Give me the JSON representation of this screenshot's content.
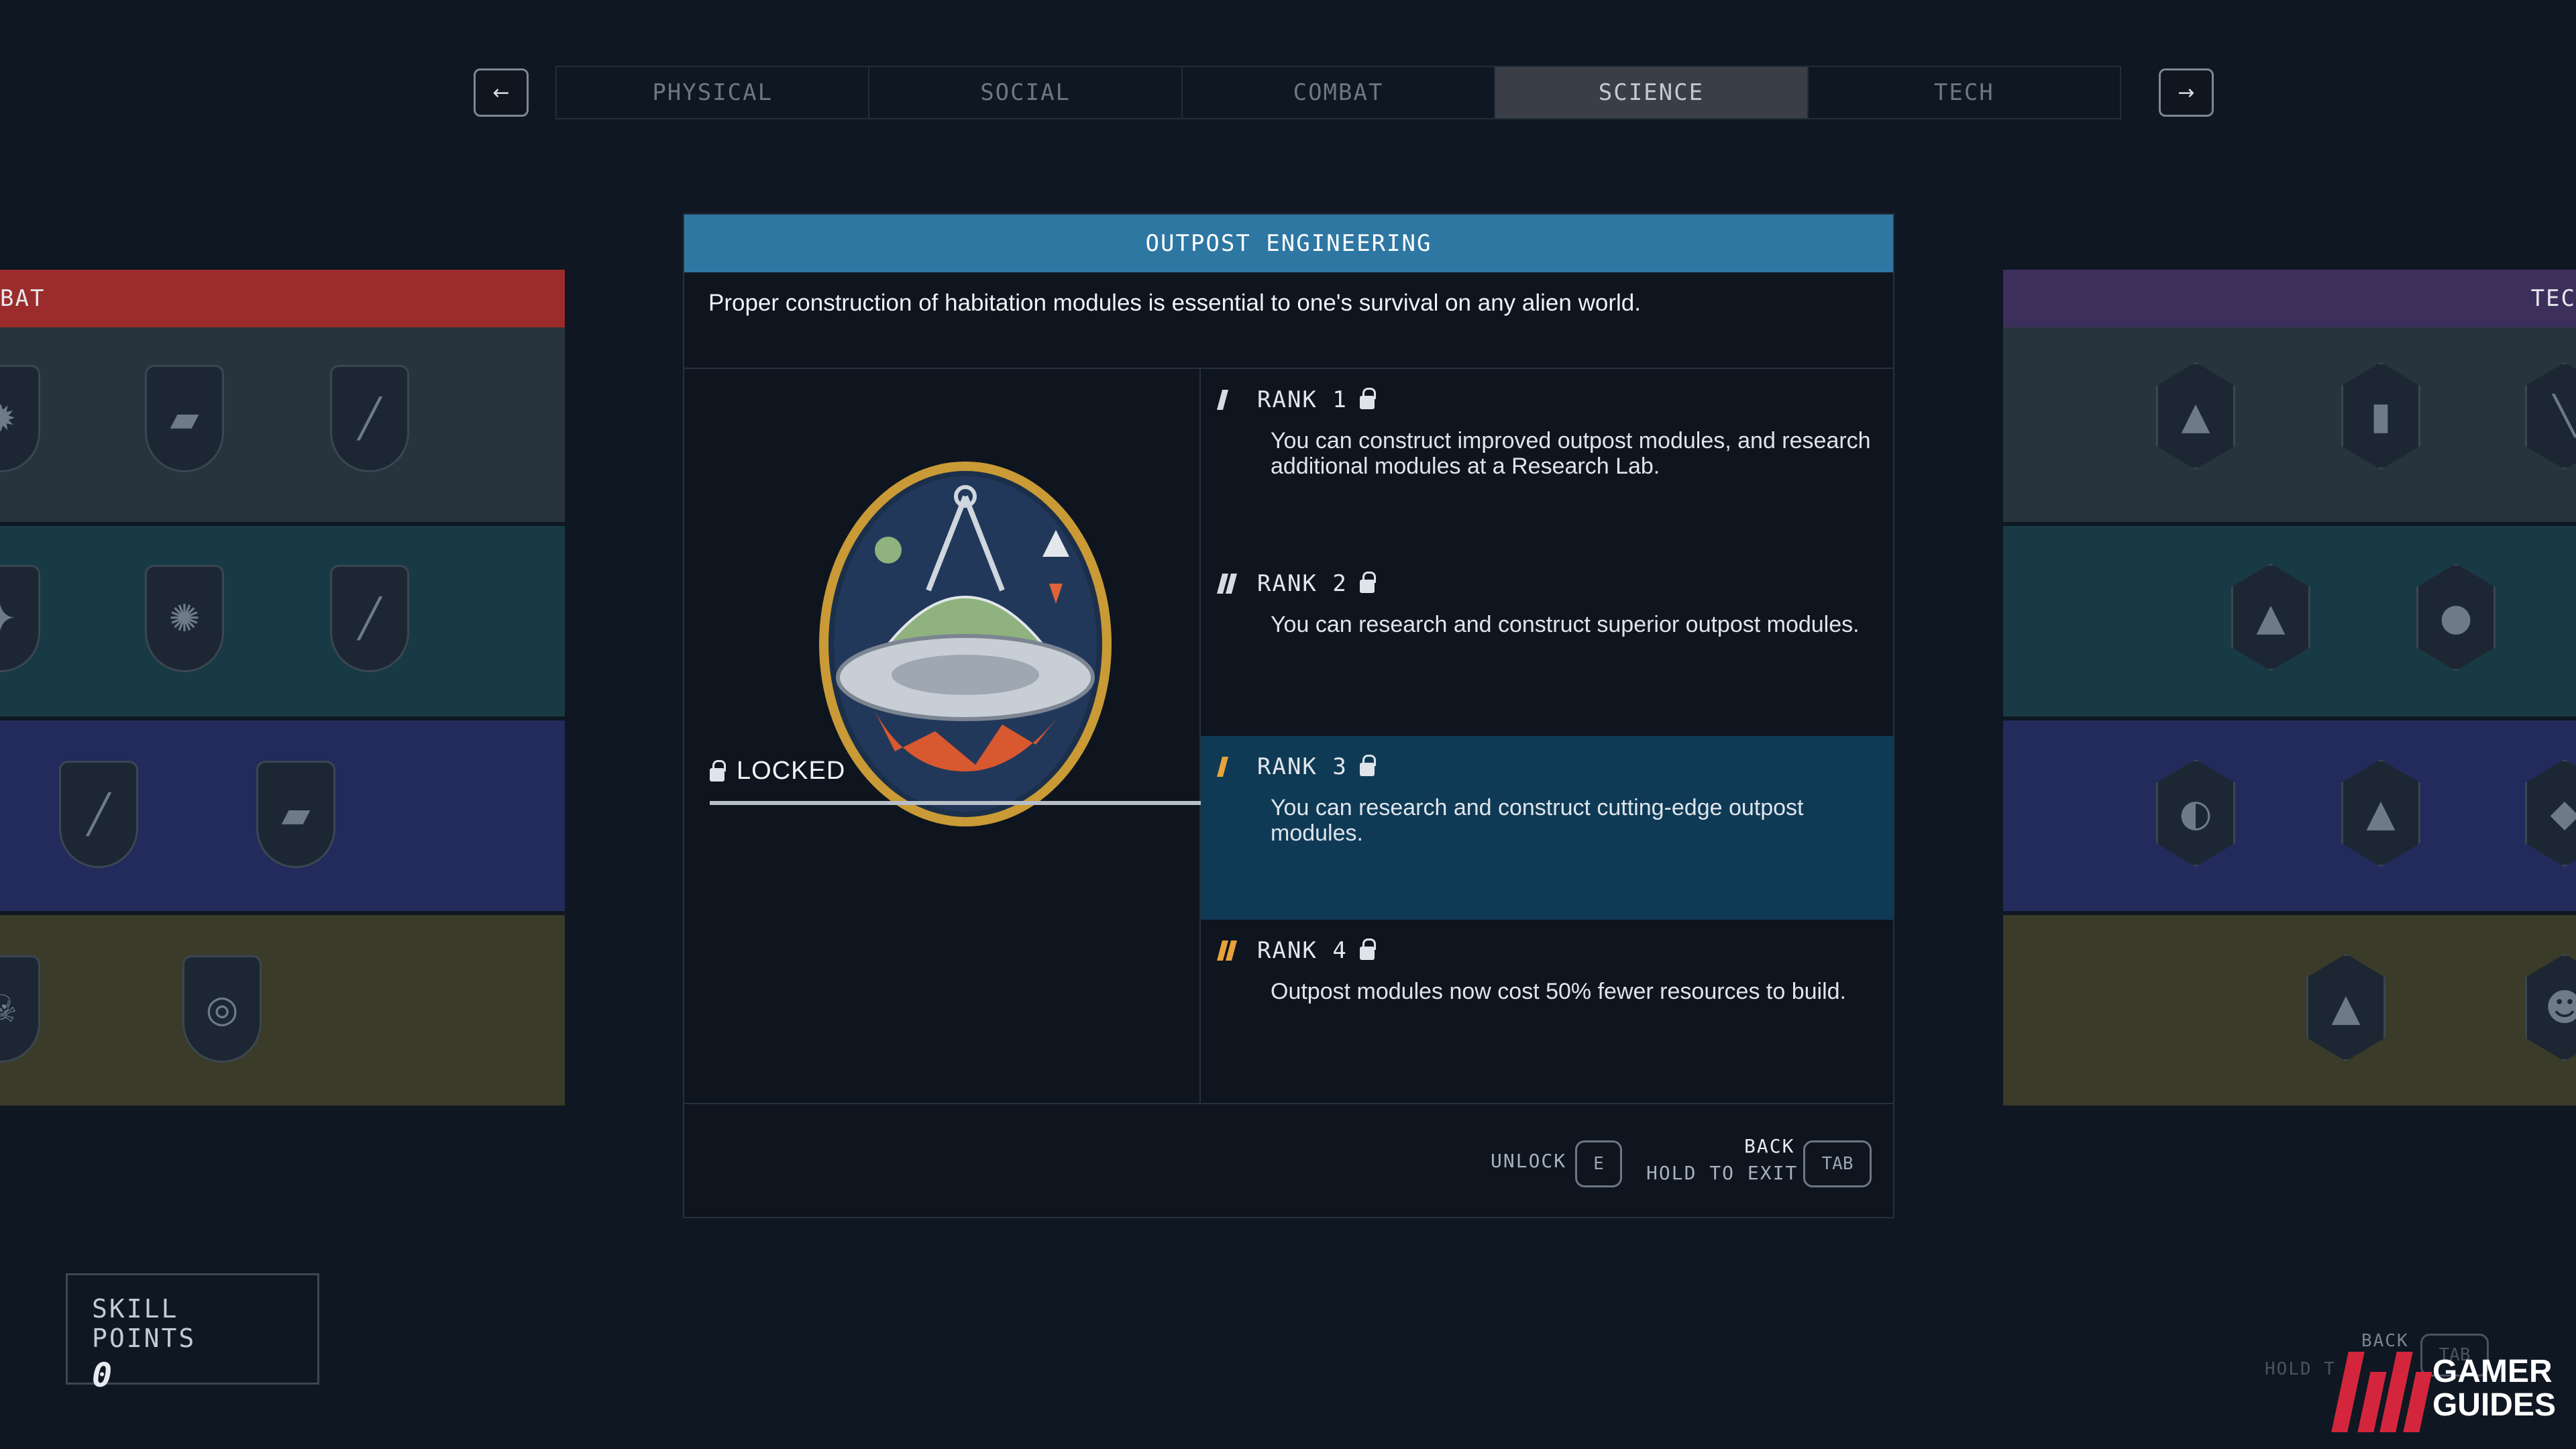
{
  "nav": {
    "prev_label": "←",
    "next_label": "→",
    "tabs": [
      {
        "label": "PHYSICAL"
      },
      {
        "label": "SOCIAL"
      },
      {
        "label": "COMBAT"
      },
      {
        "label": "SCIENCE",
        "active": true
      },
      {
        "label": "TECH"
      }
    ]
  },
  "left_panel": {
    "header": "BAT",
    "header_color": "#9c2b2b",
    "row_colors": [
      "#27343d",
      "#183a44",
      "#232b5c",
      "#3a3b28"
    ],
    "badge_icons": [
      "sun-icon",
      "pistol-icon",
      "rifle-icon",
      "star-icon",
      "burst-icon",
      "rifle-icon",
      "sniper-icon",
      "revolver-icon",
      "skull-icon",
      "target-icon"
    ]
  },
  "right_panel": {
    "header": "TEC",
    "header_color": "#3d2f5c",
    "row_colors": [
      "#27343d",
      "#183a44",
      "#232b5c",
      "#3a3b28"
    ],
    "badge_icons": [
      "ship-icon",
      "jetpack-icon",
      "tool-icon",
      "ship-icon",
      "rocket-icon",
      "planet-icon",
      "ship-icon",
      "robot-icon",
      "ship-icon",
      "astronaut-icon"
    ]
  },
  "dialog": {
    "title": "OUTPOST ENGINEERING",
    "description": "Proper construction of habitation modules is essential to one's survival on any alien world.",
    "status": "LOCKED",
    "ranks": [
      {
        "label": "RANK 1",
        "text": "You can construct improved outpost modules, and research additional modules at a Research Lab.",
        "mark_color": "#d5dbe2",
        "marks": 1
      },
      {
        "label": "RANK 2",
        "text": "You can research and construct superior outpost modules.",
        "mark_color": "#d5dbe2",
        "marks": 2
      },
      {
        "label": "RANK 3",
        "text": "You can research and construct cutting-edge outpost modules.",
        "mark_color": "#e8a23a",
        "marks": 1,
        "highlight": true
      },
      {
        "label": "RANK 4",
        "text": "Outpost modules now cost 50% fewer resources to build.",
        "mark_color": "#e8a23a",
        "marks": 2
      }
    ],
    "footer": {
      "unlock_label": "UNLOCK",
      "unlock_key": "E",
      "back_label": "BACK",
      "exit_label": "HOLD TO EXIT",
      "back_key": "TAB"
    }
  },
  "skill_points": {
    "label": "SKILL POINTS",
    "value": "0"
  },
  "ghost_footer": {
    "back_label": "BACK",
    "hold_label": "HOLD T",
    "key": "TAB"
  },
  "watermark": {
    "line1": "GAMER",
    "line2": "GUIDES"
  }
}
